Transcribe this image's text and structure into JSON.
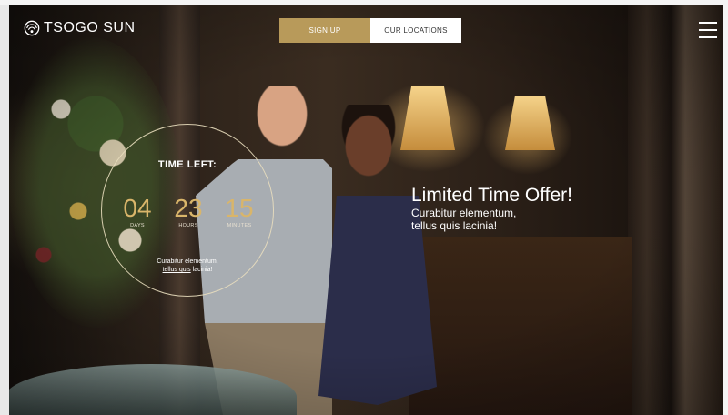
{
  "header": {
    "brand": "TSOGO SUN",
    "signup_label": "SIGN UP",
    "locations_label": "OUR LOCATIONS"
  },
  "countdown": {
    "title": "TIME LEFT:",
    "units": [
      {
        "value": "04",
        "label": "DAYS"
      },
      {
        "value": "23",
        "label": "HOURS"
      },
      {
        "value": "15",
        "label": "MINUTES"
      }
    ],
    "text_line1": "Curabitur elementum,",
    "text_link": "tellus quis",
    "text_end": "lacinia!"
  },
  "offer": {
    "title": "Limited Time Offer!",
    "line1": "Curabitur elementum,",
    "line2": "tellus quis lacinia!"
  },
  "colors": {
    "accent": "#b89a5a",
    "countdown_number": "#d9b56a"
  },
  "icons": {
    "logo": "swirl-logo-icon",
    "menu": "hamburger-menu-icon"
  }
}
